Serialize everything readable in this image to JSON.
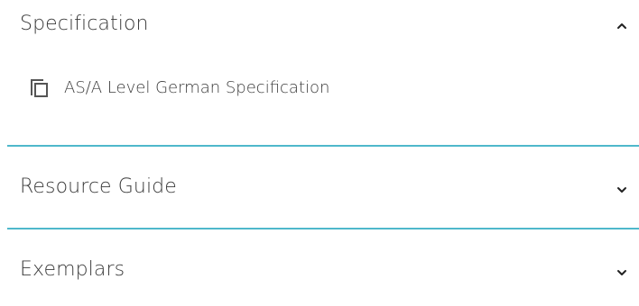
{
  "accordion": {
    "sections": [
      {
        "title": "Specification",
        "expanded": true,
        "chevron_icon": "chevron-up-icon",
        "items": [
          {
            "label": "AS/A Level German Specification",
            "icon": "copy-document-icon"
          }
        ]
      },
      {
        "title": "Resource Guide",
        "expanded": false,
        "chevron_icon": "chevron-down-icon"
      },
      {
        "title": "Exemplars",
        "expanded": false,
        "chevron_icon": "chevron-down-icon"
      }
    ],
    "divider_color": "#4fb8cb",
    "text_color": "#3b3b3b"
  }
}
